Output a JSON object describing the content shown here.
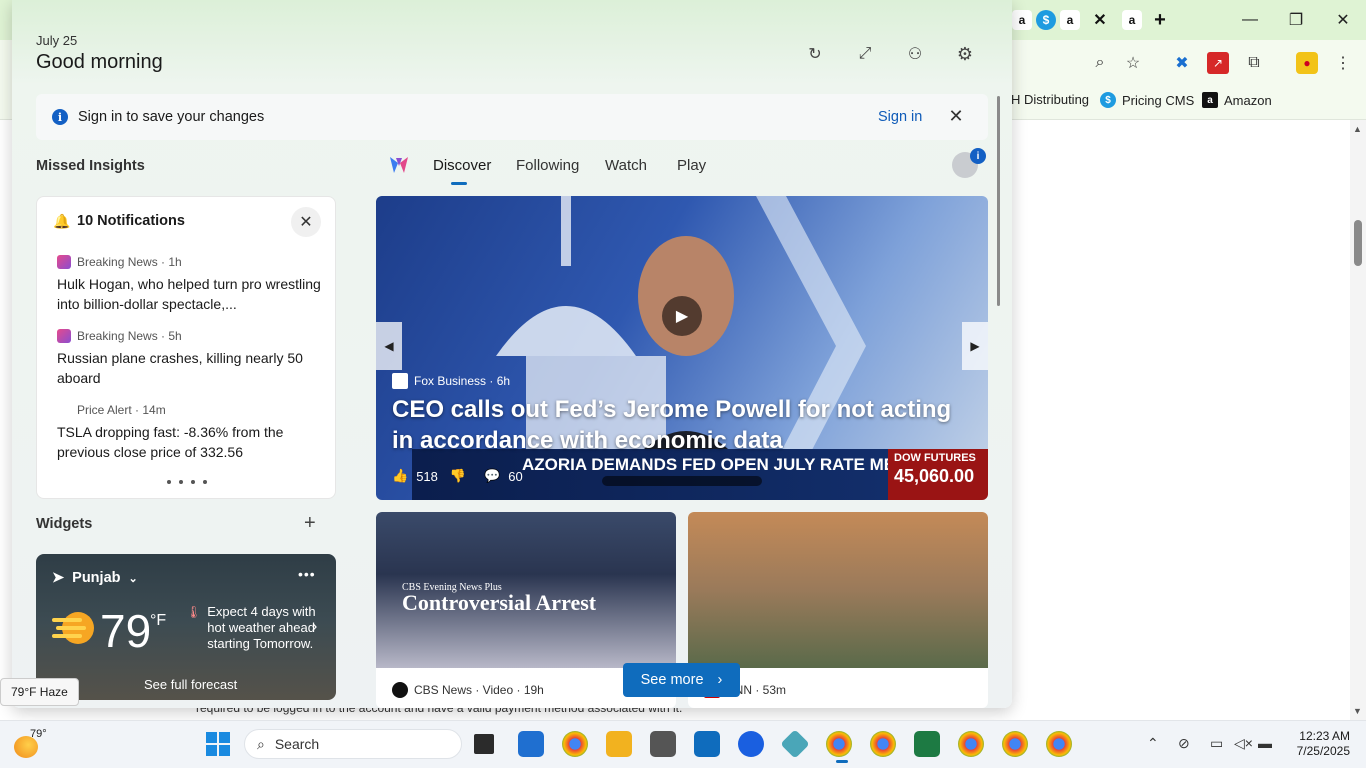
{
  "browser": {
    "bookmarks": [
      {
        "label": "H Distributing"
      },
      {
        "label": "Pricing CMS"
      },
      {
        "label": "Amazon"
      }
    ],
    "page_text_line1": "required to be logged in to the account and have a valid payment method associated with it.",
    "page_text_line2": "...",
    "window_controls": {
      "minimize": "—",
      "maximize": "❐",
      "close": "✕"
    },
    "new_tab": "+"
  },
  "panel": {
    "date": "July 25",
    "greeting": "Good morning",
    "signin": {
      "message": "Sign in to save your changes",
      "link": "Sign in"
    },
    "missed_insights": {
      "title": "Missed Insights",
      "notifications_header": "10 Notifications",
      "items": [
        {
          "source": "Breaking News · 1h",
          "text": "Hulk Hogan, who helped turn pro wrestling into billion-dollar spectacle,..."
        },
        {
          "source": "Breaking News · 5h",
          "text": "Russian plane crashes, killing nearly 50 aboard"
        },
        {
          "source": "Price Alert · 14m",
          "text": "TSLA dropping fast: -8.36% from the previous close price of 332.56"
        }
      ]
    },
    "widgets": {
      "title": "Widgets",
      "weather": {
        "location": "Punjab",
        "temp": "79",
        "unit": "°F",
        "alert": "Expect 4 days with hot weather ahead starting Tomorrow.",
        "forecast_link": "See full forecast"
      }
    },
    "feed": {
      "tabs": [
        "Discover",
        "Following",
        "Watch",
        "Play"
      ],
      "active_tab": "Discover",
      "hero": {
        "source": "Fox Business · 6h",
        "title": "CEO calls out Fed’s Jerome Powell for not acting in accordance with economic data",
        "likes": "518",
        "comments": "60",
        "ticker": "AZORIA DEMANDS FED OPEN JULY RATE MEETING",
        "dow_label": "DOW FUTURES",
        "dow_value": "45,060.00"
      },
      "cards": [
        {
          "source": "CBS News · Video · 19h",
          "overlay_small": "CBS Evening News Plus",
          "overlay_big": "Controversial Arrest"
        },
        {
          "source": "CNN · 53m"
        }
      ],
      "see_more": "See more"
    }
  },
  "taskbar": {
    "weather_tip": "79°F Haze",
    "weather_temp": "79°",
    "search_placeholder": "Search",
    "time": "12:23 AM",
    "date": "7/25/2025"
  },
  "colors": {
    "accent": "#0f6cbd",
    "panel_bg": "#eef2f3",
    "tab_strip": "#dff3d4"
  }
}
